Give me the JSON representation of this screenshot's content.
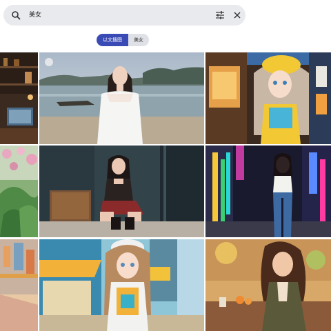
{
  "search": {
    "query": "美女",
    "icons": {
      "search": "search-icon",
      "filter": "tune-icon",
      "clear": "close-icon"
    }
  },
  "chips": [
    {
      "label": "以文搜图",
      "active": true
    },
    {
      "label": "美女",
      "active": false
    }
  ],
  "colors": {
    "accent": "#3a4bb5",
    "search_bg": "#e9eaee",
    "chip_bg": "#dfe1e6"
  },
  "images": [
    {
      "name": "image-room-shelf"
    },
    {
      "name": "image-beach-girl-white-dress"
    },
    {
      "name": "image-anime-girl-yellow-hat-street"
    },
    {
      "name": "image-pink-flowers-plants"
    },
    {
      "name": "image-girl-crouching-doorway"
    },
    {
      "name": "image-girl-neon-alley"
    },
    {
      "name": "image-sunny-street-edge"
    },
    {
      "name": "image-anime-girl-white-cap-cafe"
    },
    {
      "name": "image-girl-curly-hair-cafe"
    }
  ]
}
